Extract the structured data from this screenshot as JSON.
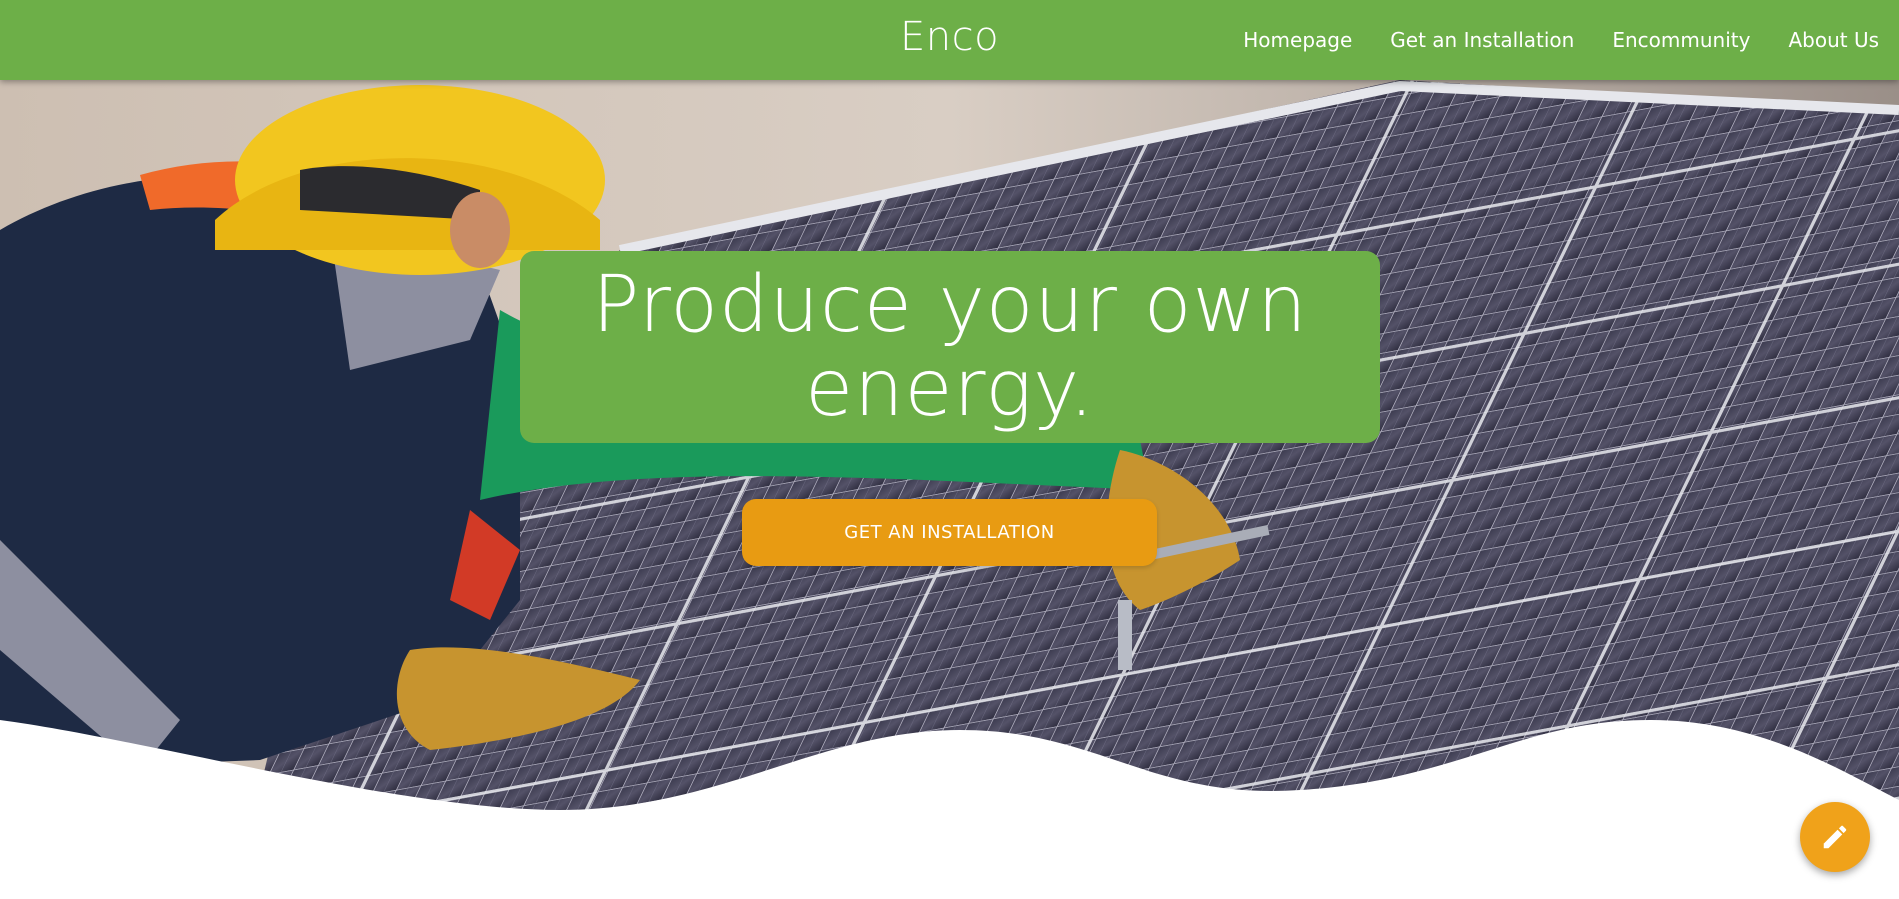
{
  "brand": {
    "name": "Enco",
    "color": "#6daf48"
  },
  "nav": {
    "items": [
      {
        "label": "Homepage"
      },
      {
        "label": "Get an Installation"
      },
      {
        "label": "Encommunity"
      },
      {
        "label": "About Us"
      }
    ]
  },
  "hero": {
    "headline": "Produce your own energy.",
    "cta_label": "GET AN INSTALLATION",
    "background_image": "worker installing solar panels",
    "accent_color": "#e89b12"
  },
  "fab": {
    "icon": "pencil-icon"
  }
}
